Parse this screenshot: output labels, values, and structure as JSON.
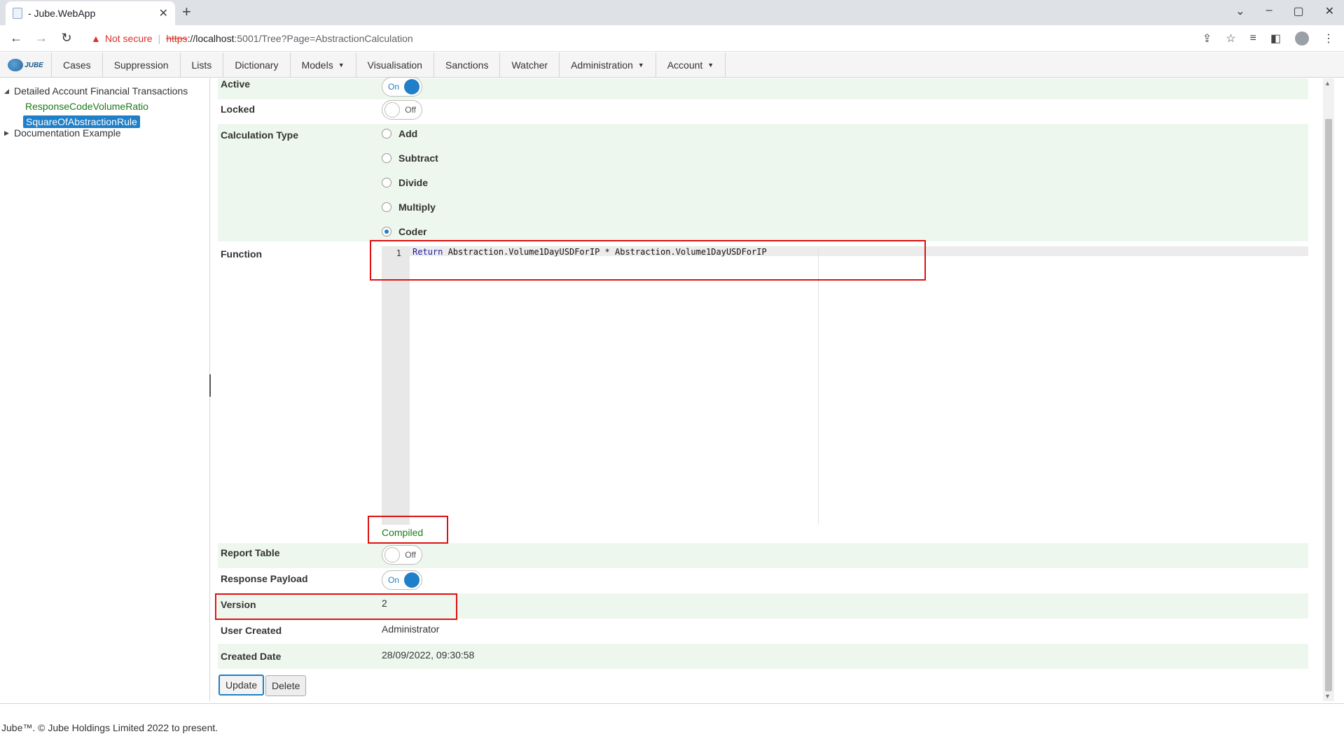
{
  "browser": {
    "tab_title": "- Jube.WebApp",
    "not_secure": "Not secure",
    "url_scheme": "https",
    "url_host": "://localhost",
    "url_path": ":5001/Tree?Page=AbstractionCalculation"
  },
  "nav": {
    "logo_text": "JUBE",
    "items": [
      {
        "label": "Cases"
      },
      {
        "label": "Suppression"
      },
      {
        "label": "Lists"
      },
      {
        "label": "Dictionary"
      },
      {
        "label": "Models",
        "dropdown": true
      },
      {
        "label": "Visualisation"
      },
      {
        "label": "Sanctions"
      },
      {
        "label": "Watcher"
      },
      {
        "label": "Administration",
        "dropdown": true
      },
      {
        "label": "Account",
        "dropdown": true
      }
    ]
  },
  "tree": {
    "nodes": [
      {
        "label": "Detailed Account Financial Transactions",
        "expanded": true,
        "children": [
          {
            "label": "ResponseCodeVolumeRatio",
            "selected": false
          },
          {
            "label": "SquareOfAbstractionRule",
            "selected": true
          }
        ]
      },
      {
        "label": "Documentation Example",
        "expanded": false
      }
    ]
  },
  "form": {
    "active": {
      "label": "Active",
      "state": "On"
    },
    "locked": {
      "label": "Locked",
      "state": "Off"
    },
    "calculation_type": {
      "label": "Calculation Type",
      "options": [
        "Add",
        "Subtract",
        "Divide",
        "Multiply",
        "Coder"
      ],
      "selected": "Coder"
    },
    "function": {
      "label": "Function",
      "line_number": "1",
      "keyword": "Return",
      "code_rest": " Abstraction.Volume1DayUSDForIP * Abstraction.Volume1DayUSDForIP",
      "status": "Compiled"
    },
    "report_table": {
      "label": "Report Table",
      "state": "Off"
    },
    "response_payload": {
      "label": "Response Payload",
      "state": "On"
    },
    "version": {
      "label": "Version",
      "value": "2"
    },
    "user_created": {
      "label": "User Created",
      "value": "Administrator"
    },
    "created_date": {
      "label": "Created Date",
      "value": "28/09/2022, 09:30:58"
    },
    "buttons": {
      "update": "Update",
      "delete": "Delete"
    }
  },
  "footer": {
    "text": "Jube™. © Jube Holdings Limited 2022 to present."
  },
  "colors": {
    "accent": "#1f7fc8",
    "success": "#1a7a1a",
    "highlight_box": "#e01010",
    "row_alt": "#eef7ee"
  }
}
